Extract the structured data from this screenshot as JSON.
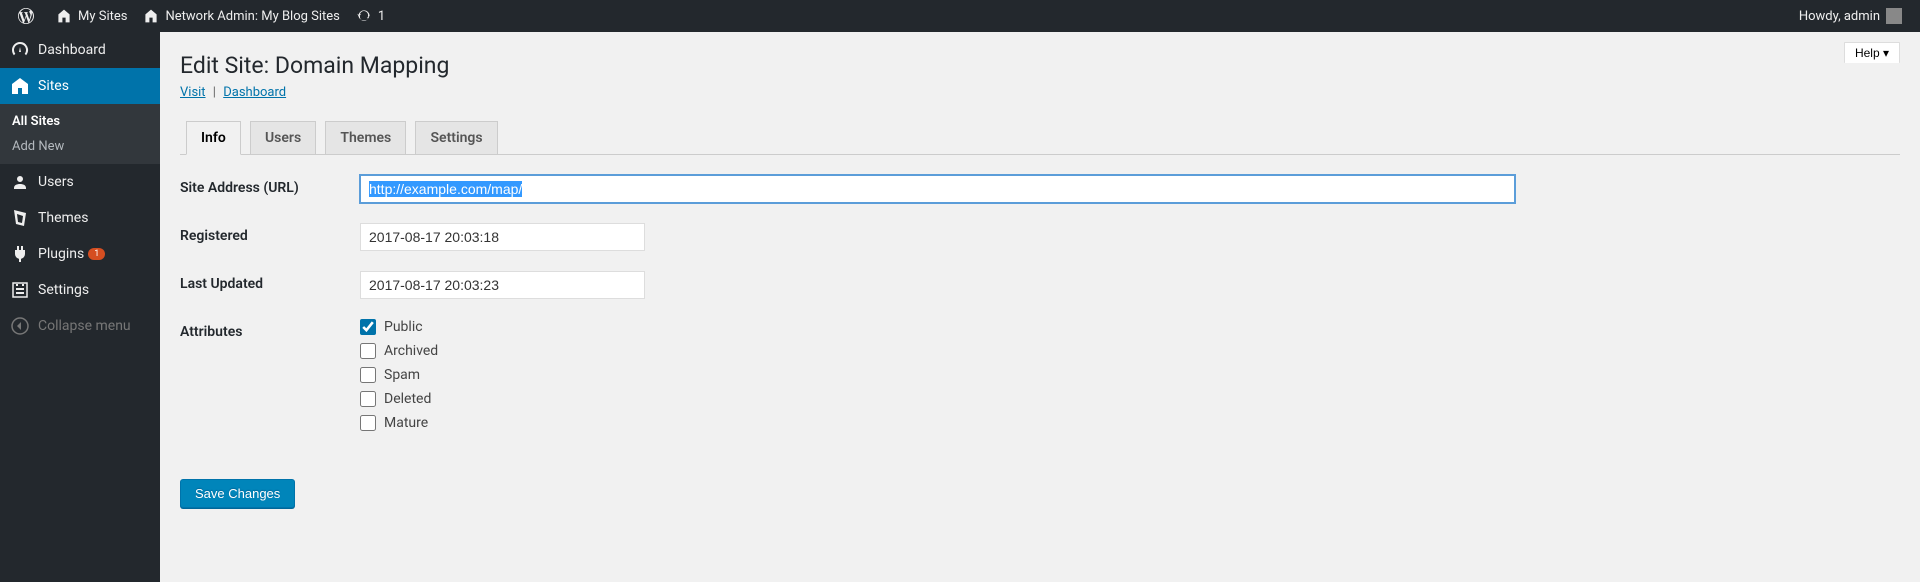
{
  "adminbar": {
    "mysites": "My Sites",
    "networkadmin": "Network Admin: My Blog Sites",
    "updates": "1",
    "howdy": "Howdy, admin"
  },
  "sidebar": {
    "dashboard": "Dashboard",
    "sites": "Sites",
    "allsites": "All Sites",
    "addnew": "Add New",
    "users": "Users",
    "themes": "Themes",
    "plugins": "Plugins",
    "plugins_badge": "1",
    "settings": "Settings",
    "collapse": "Collapse menu"
  },
  "page": {
    "title": "Edit Site: Domain Mapping",
    "help": "Help",
    "visit": "Visit",
    "dashboard": "Dashboard"
  },
  "tabs": {
    "info": "Info",
    "users": "Users",
    "themes": "Themes",
    "settings": "Settings"
  },
  "form": {
    "url_label": "Site Address (URL)",
    "url_value": "http://example.com/map/",
    "registered_label": "Registered",
    "registered_value": "2017-08-17 20:03:18",
    "updated_label": "Last Updated",
    "updated_value": "2017-08-17 20:03:23",
    "attributes_label": "Attributes",
    "public": "Public",
    "archived": "Archived",
    "spam": "Spam",
    "deleted": "Deleted",
    "mature": "Mature",
    "submit": "Save Changes"
  }
}
